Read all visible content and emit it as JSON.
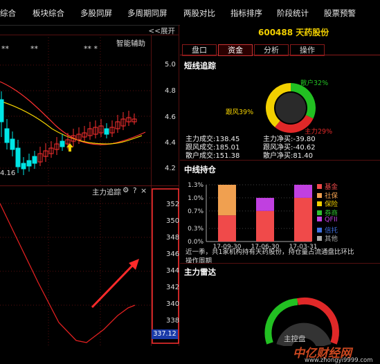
{
  "menu": [
    "综合",
    "板块综合",
    "多股同屏",
    "多周期同屏",
    "两股对比",
    "指标排序",
    "阶段统计",
    "股票预警"
  ],
  "chart_area": {
    "expand_label": "<<展开",
    "indicator_label": "智能辅助",
    "stars": [
      "**",
      "**",
      "** *"
    ],
    "price_axis": [
      "5.0",
      "4.8",
      "4.6",
      "4.4",
      "4.2"
    ],
    "low_price": "4.16",
    "lower_indicator_title": "主力追踪",
    "lower_tools": [
      "gear",
      "?",
      "×"
    ],
    "lower_axis": [
      "352",
      "350",
      "348",
      "346",
      "344",
      "342",
      "340",
      "338"
    ],
    "current_value": "337.12",
    "colors": {
      "up": "#ff3030",
      "down": "#00e5e5",
      "ma_red": "#ff3030",
      "ma_yellow": "#f2d000",
      "indicator_line": "#e02020",
      "highlight_box": "#ff3030"
    }
  },
  "stock": {
    "code": "600488",
    "name": "天药股份"
  },
  "tabs": [
    {
      "label": "盘口",
      "active": false
    },
    {
      "label": "资金",
      "active": true
    },
    {
      "label": "分析",
      "active": false
    },
    {
      "label": "操作",
      "active": false
    }
  ],
  "short_term": {
    "title": "短线追踪",
    "donut": [
      {
        "label": "散户32%",
        "value": 32,
        "color": "#22c022"
      },
      {
        "label": "主力29%",
        "value": 29,
        "color": "#e02828"
      },
      {
        "label": "跟风39%",
        "value": 39,
        "color": "#f2d000"
      }
    ],
    "stats": [
      {
        "k": "主力成交:",
        "v": "138.45"
      },
      {
        "k": "主力净买:",
        "v": "-39.80"
      },
      {
        "k": "跟风成交:",
        "v": "185.01"
      },
      {
        "k": "跟风净买:",
        "v": "-40.62"
      },
      {
        "k": "散户成交:",
        "v": "151.38"
      },
      {
        "k": "散户净买:",
        "v": "81.40"
      }
    ]
  },
  "mid_term": {
    "title": "中线持仓",
    "chart_data": {
      "type": "bar",
      "stacked": true,
      "categories": [
        "17-09-30",
        "17-06-30",
        "17-03-31"
      ],
      "ylim": [
        0,
        1.3
      ],
      "y_ticks": [
        "1.3%",
        "1.0%",
        "0.7%",
        "0.3%",
        "0.0%"
      ],
      "series": [
        {
          "name": "基金",
          "color": "#f04a4a",
          "values": [
            0.6,
            0.7,
            1.0
          ]
        },
        {
          "name": "社保",
          "color": "#f0a050",
          "values": [
            0.7,
            0.0,
            0.0
          ]
        },
        {
          "name": "保险",
          "color": "#f2d000",
          "values": [
            0.0,
            0.0,
            0.0
          ]
        },
        {
          "name": "券商",
          "color": "#30c030",
          "values": [
            0.0,
            0.0,
            0.0
          ]
        },
        {
          "name": "QFII",
          "color": "#c040e0",
          "values": [
            0.0,
            0.3,
            0.3
          ]
        },
        {
          "name": "信托",
          "color": "#4070e0",
          "values": [
            0.0,
            0.0,
            0.0
          ]
        },
        {
          "name": "其他",
          "color": "#aaaaaa",
          "values": [
            0.0,
            0.0,
            0.0
          ]
        }
      ]
    },
    "note": "近一季，共1家机构持有天药股份，持仓量占流通盘比环比",
    "note2": "操作周期"
  },
  "radar": {
    "title": "主力雷达",
    "label": "主控盘"
  },
  "watermark": {
    "main": "中亿财经网",
    "sub": "www.zhongyi9999.com"
  }
}
